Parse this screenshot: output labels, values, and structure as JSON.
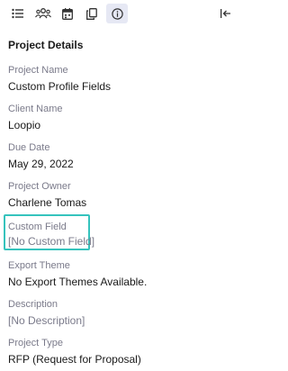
{
  "toolbar": {
    "icons": [
      "list-icon",
      "team-icon",
      "calendar-icon",
      "copy-icon",
      "info-icon",
      "collapse-panel-icon"
    ],
    "active": "info-icon"
  },
  "panel": {
    "title": "Project Details",
    "fields": [
      {
        "label": "Project Name",
        "value": "Custom Profile Fields"
      },
      {
        "label": "Client Name",
        "value": "Loopio"
      },
      {
        "label": "Due Date",
        "value": "May 29, 2022"
      },
      {
        "label": "Project Owner",
        "value": "Charlene Tomas"
      },
      {
        "label": "Custom Field",
        "value": "[No Custom Field]"
      },
      {
        "label": "Export Theme",
        "value": "No Export Themes Available."
      },
      {
        "label": "Description",
        "value": "[No Description]"
      },
      {
        "label": "Project Type",
        "value": "RFP (Request for Proposal)"
      }
    ]
  },
  "colors": {
    "highlight": "#35c3bd",
    "active_tab": "#e6e8f4",
    "label": "#7a7a8a"
  }
}
